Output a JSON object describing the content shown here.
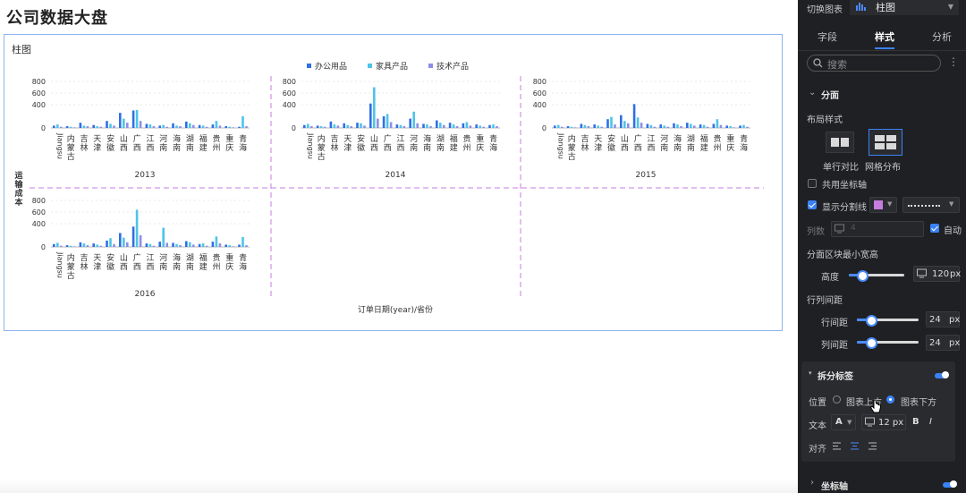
{
  "page": {
    "title": "公司数据大盘"
  },
  "card": {
    "title": "柱图"
  },
  "chart_data": {
    "type": "bar",
    "title": "柱图",
    "legend": [
      "办公用品",
      "家具产品",
      "技术产品"
    ],
    "legend_position": "top-center",
    "ylabel": "运输成本",
    "xlabel": "订单日期(year)/省份",
    "yticks": [
      0,
      400,
      600,
      800
    ],
    "ylim": [
      0,
      800
    ],
    "grid": true,
    "x_tick_labels": [
      "Jiangsu",
      "内蒙古",
      "吉林",
      "天津",
      "安徽",
      "山西",
      "广西",
      "江西",
      "河南",
      "海南",
      "湖南",
      "福建",
      "贵州",
      "重庆",
      "青海"
    ],
    "colors": {
      "办公用品": "#2f6fe4",
      "家具产品": "#4dc4ea",
      "技术产品": "#8f8de6"
    },
    "facets": [
      {
        "label": "2013",
        "series": [
          {
            "name": "办公用品",
            "values": [
              40,
              30,
              90,
              50,
              120,
              260,
              300,
              70,
              40,
              80,
              110,
              50,
              60,
              30,
              20
            ]
          },
          {
            "name": "家具产品",
            "values": [
              60,
              20,
              40,
              30,
              70,
              160,
              310,
              60,
              50,
              40,
              80,
              40,
              120,
              20,
              200
            ]
          },
          {
            "name": "技术产品",
            "values": [
              20,
              10,
              30,
              20,
              40,
              90,
              120,
              30,
              20,
              30,
              50,
              20,
              40,
              10,
              30
            ]
          }
        ]
      },
      {
        "label": "2014",
        "series": [
          {
            "name": "办公用品",
            "values": [
              50,
              40,
              110,
              80,
              90,
              420,
              200,
              60,
              160,
              70,
              130,
              90,
              80,
              60,
              50
            ]
          },
          {
            "name": "家具产品",
            "values": [
              70,
              30,
              60,
              50,
              80,
              700,
              240,
              50,
              280,
              60,
              90,
              60,
              100,
              40,
              60
            ]
          },
          {
            "name": "技术产品",
            "values": [
              30,
              20,
              40,
              30,
              40,
              160,
              100,
              30,
              80,
              30,
              50,
              30,
              40,
              20,
              30
            ]
          }
        ]
      },
      {
        "label": "2015",
        "series": [
          {
            "name": "办公用品",
            "values": [
              40,
              30,
              70,
              60,
              150,
              220,
              410,
              70,
              60,
              80,
              90,
              60,
              70,
              40,
              40
            ]
          },
          {
            "name": "家具产品",
            "values": [
              50,
              20,
              50,
              40,
              190,
              120,
              180,
              50,
              40,
              60,
              70,
              50,
              150,
              30,
              50
            ]
          },
          {
            "name": "技术产品",
            "values": [
              20,
              10,
              30,
              20,
              60,
              80,
              90,
              20,
              20,
              30,
              40,
              20,
              50,
              10,
              20
            ]
          }
        ]
      },
      {
        "label": "2016",
        "series": [
          {
            "name": "办公用品",
            "values": [
              50,
              30,
              80,
              60,
              110,
              240,
              350,
              60,
              90,
              70,
              100,
              50,
              90,
              40,
              40
            ]
          },
          {
            "name": "家具产品",
            "values": [
              70,
              20,
              60,
              40,
              150,
              160,
              640,
              50,
              330,
              50,
              80,
              60,
              180,
              30,
              170
            ]
          },
          {
            "name": "技术产品",
            "values": [
              20,
              10,
              30,
              20,
              50,
              80,
              200,
              20,
              70,
              30,
              40,
              20,
              60,
              10,
              30
            ]
          }
        ]
      }
    ]
  },
  "panel": {
    "switch_label": "切换图表",
    "chart_type": "柱图",
    "tabs": [
      "字段",
      "样式",
      "分析"
    ],
    "search_placeholder": "搜索",
    "section_facet": "分面",
    "layout_style_label": "布局样式",
    "layout_single": "单行对比",
    "layout_grid": "网格分布",
    "shared_axis_label": "共用坐标轴",
    "show_divider_label": "显示分割线",
    "divider_color": "#c77de0",
    "columns_label": "列数",
    "columns_value": "4",
    "auto_label": "自动",
    "min_size_label": "分面区块最小宽高",
    "height_label": "高度",
    "height_value": "120",
    "height_unit": "px",
    "spacing_label": "行列间距",
    "row_gap_label": "行间距",
    "row_gap_value": "24",
    "col_gap_label": "列间距",
    "col_gap_value": "24",
    "px": "px",
    "split_label_section": "拆分标签",
    "position_label": "位置",
    "position_above": "图表上方",
    "position_below": "图表下方",
    "text_label": "文本",
    "font_glyph": "A",
    "font_size": "12 px",
    "bold_glyph": "B",
    "italic_glyph": "I",
    "align_label": "对齐",
    "axis_section": "坐标轴"
  }
}
